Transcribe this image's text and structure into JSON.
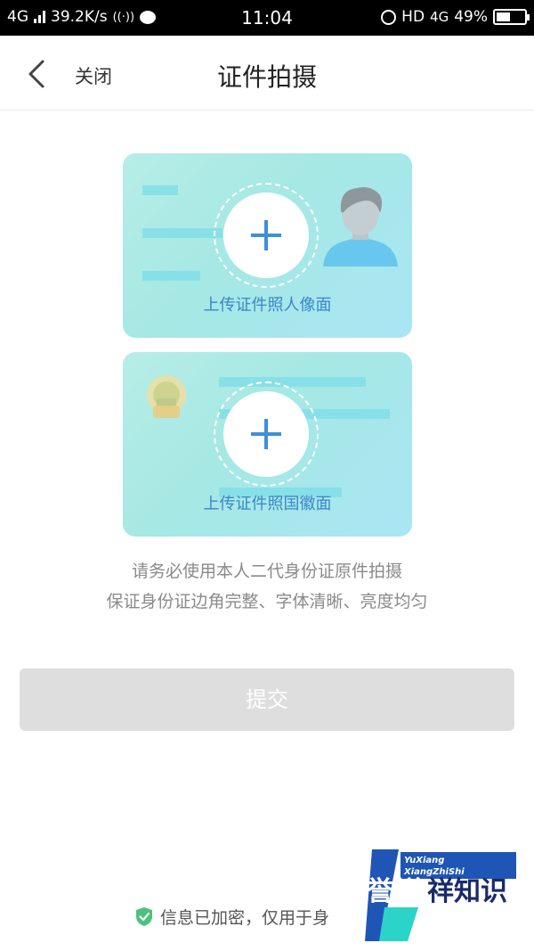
{
  "status_bar": {
    "network_left": "4G",
    "speed": "39.2K/s",
    "time": "11:04",
    "hd": "HD",
    "network_right": "4G",
    "battery": "49%",
    "battery_level": 0.49
  },
  "nav": {
    "close_label": "关闭",
    "title": "证件拍摄"
  },
  "cards": {
    "front_label": "上传证件照人像面",
    "back_label": "上传证件照国徽面"
  },
  "hints": [
    "请务必使用本人二代身份证原件拍摄",
    "保证身份证边角完整、字体清晰、亮度均匀"
  ],
  "submit_label": "提交",
  "footer": {
    "secure_text": "信息已加密，仅用于身"
  },
  "watermark": {
    "line1": "YuXiang",
    "line2": "XiangZhiShi",
    "char1": "誉",
    "char2": "祥",
    "rest": "祥知识"
  },
  "colors": {
    "accent": "#3d8fd8",
    "card_bg": "#a9e9e6",
    "submit_bg": "#dedede",
    "shield": "#4cc27a"
  }
}
